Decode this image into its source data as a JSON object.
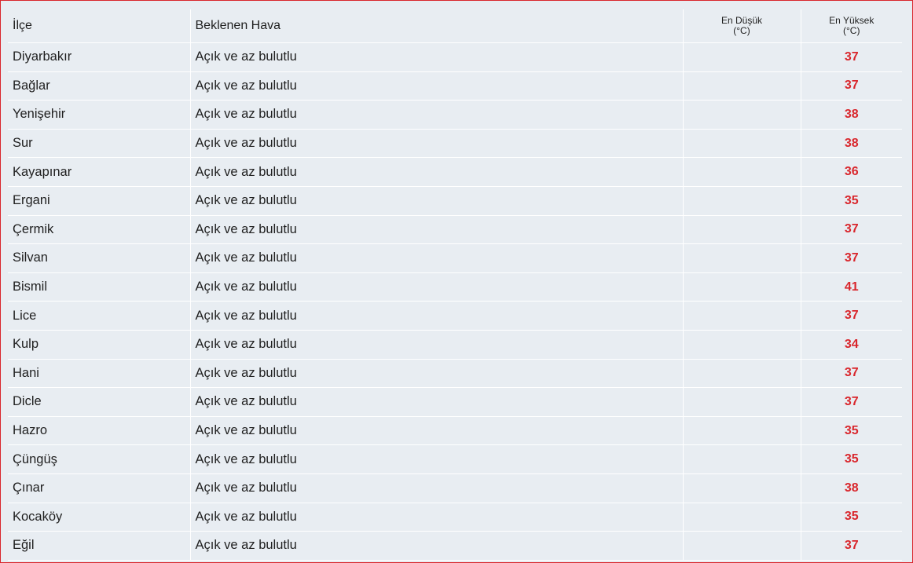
{
  "table": {
    "headers": {
      "district": "İlçe",
      "weather": "Beklenen Hava",
      "low": "En Düşük",
      "low_unit": "(°C)",
      "high": "En Yüksek",
      "high_unit": "(°C)"
    },
    "rows": [
      {
        "district": "Diyarbakır",
        "weather": "Açık ve az bulutlu",
        "low": "",
        "high": "37"
      },
      {
        "district": "Bağlar",
        "weather": "Açık ve az bulutlu",
        "low": "",
        "high": "37"
      },
      {
        "district": "Yenişehir",
        "weather": "Açık ve az bulutlu",
        "low": "",
        "high": "38"
      },
      {
        "district": "Sur",
        "weather": "Açık ve az bulutlu",
        "low": "",
        "high": "38"
      },
      {
        "district": "Kayapınar",
        "weather": "Açık ve az bulutlu",
        "low": "",
        "high": "36"
      },
      {
        "district": "Ergani",
        "weather": "Açık ve az bulutlu",
        "low": "",
        "high": "35"
      },
      {
        "district": "Çermik",
        "weather": "Açık ve az bulutlu",
        "low": "",
        "high": "37"
      },
      {
        "district": "Silvan",
        "weather": "Açık ve az bulutlu",
        "low": "",
        "high": "37"
      },
      {
        "district": "Bismil",
        "weather": "Açık ve az bulutlu",
        "low": "",
        "high": "41"
      },
      {
        "district": "Lice",
        "weather": "Açık ve az bulutlu",
        "low": "",
        "high": "37"
      },
      {
        "district": "Kulp",
        "weather": "Açık ve az bulutlu",
        "low": "",
        "high": "34"
      },
      {
        "district": "Hani",
        "weather": "Açık ve az bulutlu",
        "low": "",
        "high": "37"
      },
      {
        "district": "Dicle",
        "weather": "Açık ve az bulutlu",
        "low": "",
        "high": "37"
      },
      {
        "district": "Hazro",
        "weather": "Açık ve az bulutlu",
        "low": "",
        "high": "35"
      },
      {
        "district": "Çüngüş",
        "weather": "Açık ve az bulutlu",
        "low": "",
        "high": "35"
      },
      {
        "district": "Çınar",
        "weather": "Açık ve az bulutlu",
        "low": "",
        "high": "38"
      },
      {
        "district": "Kocaköy",
        "weather": "Açık ve az bulutlu",
        "low": "",
        "high": "35"
      },
      {
        "district": "Eğil",
        "weather": "Açık ve az bulutlu",
        "low": "",
        "high": "37"
      }
    ]
  },
  "colors": {
    "accent": "#d9262c",
    "cell_background": "#e8edf2",
    "grid_line": "#ffffff",
    "text": "#1f1f1f"
  }
}
